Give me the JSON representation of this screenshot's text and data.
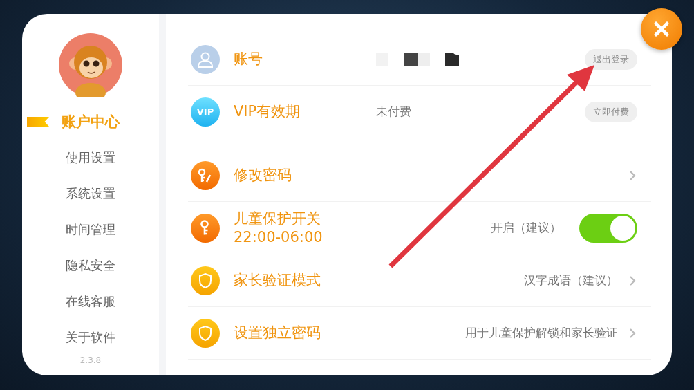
{
  "sidebar": {
    "items": [
      {
        "label": "账户中心",
        "selected": true
      },
      {
        "label": "使用设置",
        "selected": false
      },
      {
        "label": "系统设置",
        "selected": false
      },
      {
        "label": "时间管理",
        "selected": false
      },
      {
        "label": "隐私安全",
        "selected": false
      },
      {
        "label": "在线客服",
        "selected": false
      },
      {
        "label": "关于软件",
        "selected": false
      }
    ],
    "version": "2.3.8"
  },
  "groups": [
    {
      "rows": [
        {
          "kind": "account",
          "title": "账号",
          "action": "退出登录"
        },
        {
          "kind": "vip",
          "icon_text": "VIP",
          "title": "VIP有效期",
          "value": "未付费",
          "action": "立即付费"
        }
      ]
    },
    {
      "rows": [
        {
          "kind": "password",
          "title": "修改密码"
        },
        {
          "kind": "toggle",
          "title": "儿童保护开关",
          "subtitle": "22:00-06:00",
          "value": "开启（建议）",
          "on": true
        },
        {
          "kind": "shield",
          "title": "家长验证模式",
          "value": "汉字成语（建议）"
        },
        {
          "kind": "shield",
          "title": "设置独立密码",
          "value": "用于儿童保护解锁和家长验证"
        }
      ]
    }
  ]
}
